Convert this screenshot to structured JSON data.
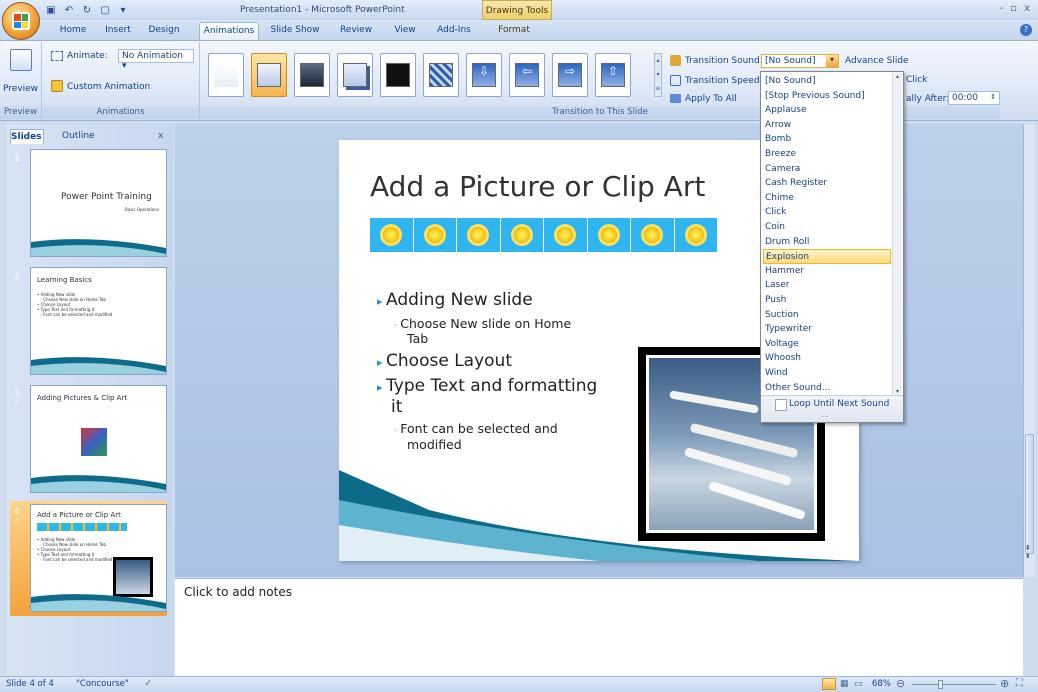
{
  "window": {
    "title": "Presentation1 - Microsoft PowerPoint",
    "context_tab": "Drawing Tools",
    "controls": "- ▫ x"
  },
  "tabs": [
    "Home",
    "Insert",
    "Design",
    "Animations",
    "Slide Show",
    "Review",
    "View",
    "Add-Ins",
    "Format"
  ],
  "ribbon": {
    "preview": {
      "button": "Preview",
      "group": "Preview"
    },
    "animations": {
      "animate_label": "Animate:",
      "animate_value": "No Animation",
      "custom": "Custom Animation",
      "group": "Animations"
    },
    "transition": {
      "group": "Transition to This Slide",
      "sound_label": "Transition Sound:",
      "sound_value": "[No Sound]",
      "speed_label": "Transition Speed:",
      "apply_all": "Apply To All",
      "advance": "Advance Slide",
      "on_click": "Click",
      "auto_label": "ally After:",
      "auto_value": "00:00"
    }
  },
  "pane_tabs": {
    "slides": "Slides",
    "outline": "Outline",
    "close": "x"
  },
  "thumbnails": [
    {
      "num": "1",
      "title": "Power Point Training",
      "sub": "Basic Operations"
    },
    {
      "num": "2",
      "title": "Learning Basics",
      "lines": [
        "• Adding New slide",
        "  ◦ Choose New slide on Home Tab",
        "• Choose Layout",
        "• Type Text and formatting it",
        "  ◦ Font can be selected and modified"
      ]
    },
    {
      "num": "3",
      "title": "Adding Pictures & Clip Art"
    },
    {
      "num": "4",
      "title": "Add a Picture or Clip Art",
      "lines": [
        "• Adding New slide",
        "  ◦ Choose New slide on Home Tab",
        "• Choose Layout",
        "• Type Text and formatting it",
        "  ◦ Font can be selected and modified"
      ]
    }
  ],
  "slide": {
    "title": "Add a Picture or Clip Art",
    "b1": "Adding New slide",
    "b1a": "Choose New slide on Home",
    "b1b": "Tab",
    "b2": "Choose Layout",
    "b3": "Type Text and formatting",
    "b3b": "it",
    "b3c": "Font can be selected and",
    "b3d": "modified"
  },
  "notes": "Click to add notes",
  "dropdown": {
    "items": [
      "[No Sound]",
      "[Stop Previous Sound]",
      "Applause",
      "Arrow",
      "Bomb",
      "Breeze",
      "Camera",
      "Cash Register",
      "Chime",
      "Click",
      "Coin",
      "Drum Roll",
      "Explosion",
      "Hammer",
      "Laser",
      "Push",
      "Suction",
      "Typewriter",
      "Voltage",
      "Whoosh",
      "Wind",
      "Other Sound..."
    ],
    "selected": "Explosion",
    "loop": "Loop Until Next Sound"
  },
  "status": {
    "slide": "Slide 4 of 4",
    "theme": "\"Concourse\"",
    "zoom": "68%"
  }
}
